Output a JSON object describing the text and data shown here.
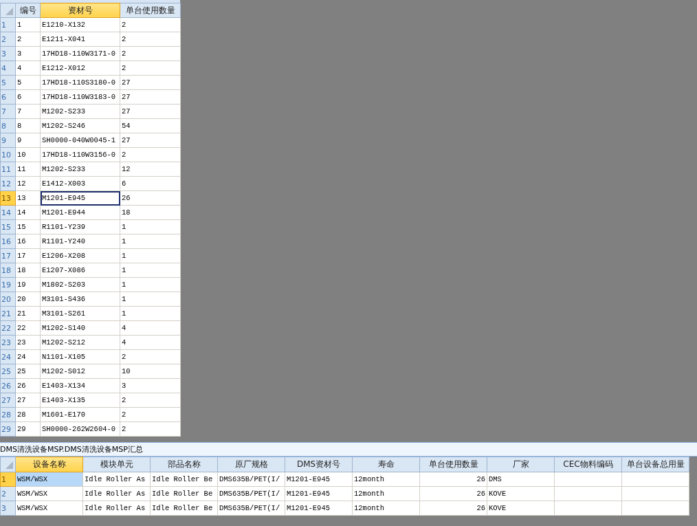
{
  "top_grid": {
    "active_cell_filled": false,
    "columns": [
      {
        "label": "编号",
        "selected": false,
        "right_aligned": false
      },
      {
        "label": "资材号",
        "selected": true,
        "right_aligned": false
      },
      {
        "label": "单台使用数量",
        "selected": false,
        "right_aligned": false
      }
    ],
    "rows": [
      {
        "header": "1",
        "selected": false,
        "cells": [
          "1",
          "E1210-X132",
          "2"
        ]
      },
      {
        "header": "2",
        "selected": false,
        "cells": [
          "2",
          "E1211-X041",
          "2"
        ]
      },
      {
        "header": "3",
        "selected": false,
        "cells": [
          "3",
          "17HD18-110W3171-0",
          "2"
        ]
      },
      {
        "header": "4",
        "selected": false,
        "cells": [
          "4",
          "E1212-X012",
          "2"
        ]
      },
      {
        "header": "5",
        "selected": false,
        "cells": [
          "5",
          "17HD18-110S3180-0",
          "27"
        ]
      },
      {
        "header": "6",
        "selected": false,
        "cells": [
          "6",
          "17HD18-110W3183-0",
          "27"
        ]
      },
      {
        "header": "7",
        "selected": false,
        "cells": [
          "7",
          "M1202-S233",
          "27"
        ]
      },
      {
        "header": "8",
        "selected": false,
        "cells": [
          "8",
          "M1202-S246",
          "54"
        ]
      },
      {
        "header": "9",
        "selected": false,
        "cells": [
          "9",
          "SH0000-040W0045-1",
          "27"
        ]
      },
      {
        "header": "10",
        "selected": false,
        "cells": [
          "10",
          "17HD18-110W3156-0",
          "2"
        ]
      },
      {
        "header": "11",
        "selected": false,
        "cells": [
          "11",
          "M1202-S233",
          "12"
        ]
      },
      {
        "header": "12",
        "selected": false,
        "cells": [
          "12",
          "E1412-X003",
          "6"
        ]
      },
      {
        "header": "13",
        "selected": true,
        "cells": [
          "13",
          "M1201-E945",
          "26"
        ]
      },
      {
        "header": "14",
        "selected": false,
        "cells": [
          "14",
          "M1201-E944",
          "18"
        ]
      },
      {
        "header": "15",
        "selected": false,
        "cells": [
          "15",
          "R1101-Y239",
          "1"
        ]
      },
      {
        "header": "16",
        "selected": false,
        "cells": [
          "16",
          "R1101-Y240",
          "1"
        ]
      },
      {
        "header": "17",
        "selected": false,
        "cells": [
          "17",
          "E1206-X208",
          "1"
        ]
      },
      {
        "header": "18",
        "selected": false,
        "cells": [
          "18",
          "E1207-X086",
          "1"
        ]
      },
      {
        "header": "19",
        "selected": false,
        "cells": [
          "19",
          "M1802-S203",
          "1"
        ]
      },
      {
        "header": "20",
        "selected": false,
        "cells": [
          "20",
          "M3101-S436",
          "1"
        ]
      },
      {
        "header": "21",
        "selected": false,
        "cells": [
          "21",
          "M3101-S261",
          "1"
        ]
      },
      {
        "header": "22",
        "selected": false,
        "cells": [
          "22",
          "M1202-S140",
          "4"
        ]
      },
      {
        "header": "23",
        "selected": false,
        "cells": [
          "23",
          "M1202-S212",
          "4"
        ]
      },
      {
        "header": "24",
        "selected": false,
        "cells": [
          "24",
          "N1101-X105",
          "2"
        ]
      },
      {
        "header": "25",
        "selected": false,
        "cells": [
          "25",
          "M1202-S012",
          "10"
        ]
      },
      {
        "header": "26",
        "selected": false,
        "cells": [
          "26",
          "E1403-X134",
          "3"
        ]
      },
      {
        "header": "27",
        "selected": false,
        "cells": [
          "27",
          "E1403-X135",
          "2"
        ]
      },
      {
        "header": "28",
        "selected": false,
        "cells": [
          "28",
          "M1601-E170",
          "2"
        ]
      },
      {
        "header": "29",
        "selected": false,
        "cells": [
          "29",
          "SH0000-262W2604-0",
          "2"
        ]
      }
    ]
  },
  "caption": "DMS清洗设备MSP.DMS清洗设备MSP汇总",
  "bottom_grid": {
    "active_cell_filled": true,
    "columns": [
      {
        "label": "设备名称",
        "selected": true,
        "right_aligned": false
      },
      {
        "label": "模块单元",
        "selected": false,
        "right_aligned": false
      },
      {
        "label": "部品名称",
        "selected": false,
        "right_aligned": false
      },
      {
        "label": "原厂规格",
        "selected": false,
        "right_aligned": false
      },
      {
        "label": "DMS资材号",
        "selected": false,
        "right_aligned": false
      },
      {
        "label": "寿命",
        "selected": false,
        "right_aligned": false
      },
      {
        "label": "单台使用数量",
        "selected": false,
        "right_aligned": true
      },
      {
        "label": "厂家",
        "selected": false,
        "right_aligned": false
      },
      {
        "label": "CEC物料编码",
        "selected": false,
        "right_aligned": false
      },
      {
        "label": "单台设备总用量",
        "selected": false,
        "right_aligned": false
      }
    ],
    "rows": [
      {
        "header": "1",
        "selected": true,
        "cells": [
          "WSM/WSX",
          "Idle Roller As",
          "Idle Roller Be",
          "DMS635B/PET(I/",
          "M1201-E945",
          "12month",
          "26",
          "DMS",
          "",
          ""
        ]
      },
      {
        "header": "2",
        "selected": false,
        "cells": [
          "WSM/WSX",
          "Idle Roller As",
          "Idle Roller Be",
          "DMS635B/PET(I/",
          "M1201-E945",
          "12month",
          "26",
          "KOVE",
          "",
          ""
        ]
      },
      {
        "header": "3",
        "selected": false,
        "cells": [
          "WSM/WSX",
          "Idle Roller As",
          "Idle Roller Be",
          "DMS635B/PET(I/",
          "M1201-E945",
          "12month",
          "26",
          "KOVE",
          "",
          ""
        ]
      }
    ]
  }
}
